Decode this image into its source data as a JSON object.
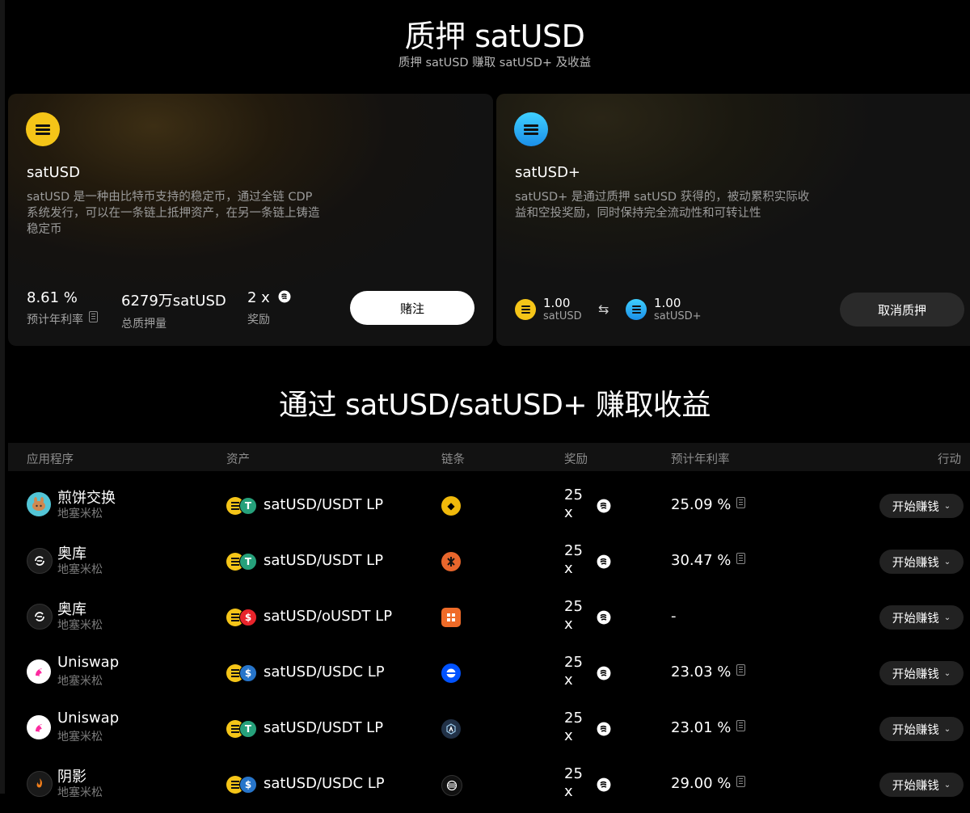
{
  "hero": {
    "title": "质押 satUSD",
    "subtitle": "质押 satUSD 赚取 satUSD+ 及收益"
  },
  "card_satusd": {
    "name": "satUSD",
    "description": "satUSD 是一种由比特币支持的稳定币，通过全链 CDP 系统发行，可以在一条链上抵押资产，在另一条链上铸造稳定币",
    "apy_value": "8.61 %",
    "apy_label": "预计年利率",
    "total_staked_value": "6279万satUSD",
    "total_staked_label": "总质押量",
    "reward_value": "2 x",
    "reward_label": "奖励",
    "stake_button": "赌注",
    "coin_color": "#f5c518"
  },
  "card_satusdplus": {
    "name": "satUSD+",
    "description": "satUSD+ 是通过质押 satUSD 获得的，被动累积实际收益和空投奖励，同时保持完全流动性和可转让性",
    "rate_from_value": "1.00",
    "rate_from_label": "satUSD",
    "rate_to_value": "1.00",
    "rate_to_label": "satUSD+",
    "swap_icon": "⇆",
    "unstake_button": "取消质押"
  },
  "section": {
    "title": "通过 satUSD/satUSD+ 赚取收益"
  },
  "table": {
    "headers": {
      "app": "应用程序",
      "asset": "资产",
      "chain": "链条",
      "reward": "奖励",
      "apr": "预计年利率",
      "action": "行动"
    },
    "rows": [
      {
        "app": "煎饼交换",
        "network": "地塞米松",
        "app_icon": "pancake-icon",
        "asset": "satUSD/USDT LP",
        "second_coin": "tether-icon",
        "chain_icon": "bnb-chain-icon",
        "reward": "25 x",
        "apr": "25.09 %",
        "action": "开始赚钱"
      },
      {
        "app": "奥库",
        "network": "地塞米松",
        "app_icon": "okx-wallet-icon",
        "asset": "satUSD/USDT LP",
        "second_coin": "tether-icon",
        "chain_icon": "bitlayer-chain-icon",
        "reward": "25 x",
        "apr": "30.47 %",
        "action": "开始赚钱"
      },
      {
        "app": "奥库",
        "network": "地塞米松",
        "app_icon": "okx-wallet-icon",
        "asset": "satUSD/oUSDT LP",
        "second_coin": "ousdt-icon",
        "chain_icon": "merlin-chain-icon",
        "reward": "25 x",
        "apr": "-",
        "action": "开始赚钱"
      },
      {
        "app": "Uniswap",
        "network": "地塞米松",
        "app_icon": "uniswap-icon",
        "asset": "satUSD/USDC LP",
        "second_coin": "usdc-icon",
        "chain_icon": "base-chain-icon",
        "reward": "25 x",
        "apr": "23.03 %",
        "action": "开始赚钱"
      },
      {
        "app": "Uniswap",
        "network": "地塞米松",
        "app_icon": "uniswap-icon",
        "asset": "satUSD/USDT LP",
        "second_coin": "tether-icon",
        "chain_icon": "arbitrum-chain-icon",
        "reward": "25 x",
        "apr": "23.01 %",
        "action": "开始赚钱"
      },
      {
        "app": "阴影",
        "network": "地塞米松",
        "app_icon": "shadow-icon",
        "asset": "satUSD/USDC LP",
        "second_coin": "usdc-icon",
        "chain_icon": "sonic-chain-icon",
        "reward": "25 x",
        "apr": "29.00 %",
        "action": "开始赚钱"
      }
    ]
  }
}
